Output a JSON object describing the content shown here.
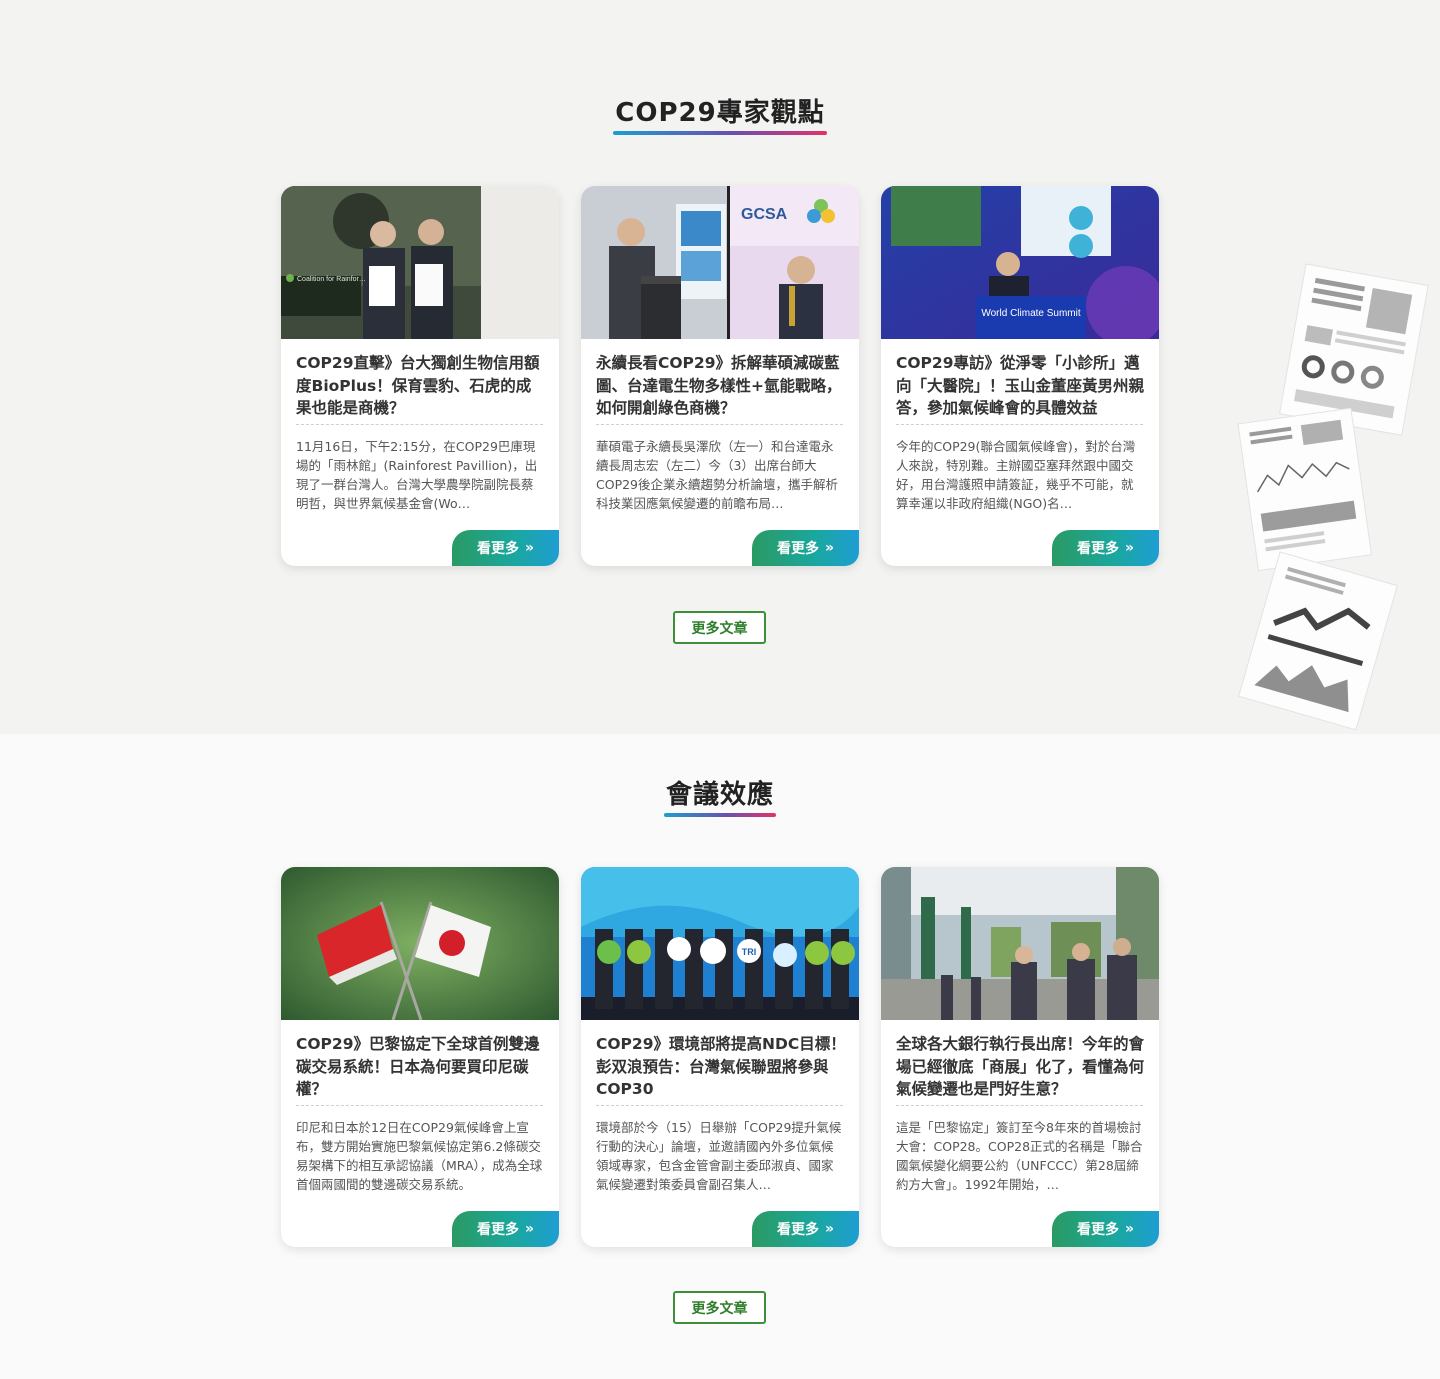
{
  "sections": [
    {
      "title": "COP29專家觀點",
      "more_label": "更多文章",
      "cards": [
        {
          "title": "COP29直擊》台大獨創生物信用額度BioPlus！保育雲豹、石虎的成果也能是商機？",
          "desc": "11月16日，下午2:15分，在COP29巴庫現場的「雨林館」(Rainforest Pavillion)，出現了一群台灣人。台灣大學農學院副院長蔡明哲，與世界氣候基金會(Wo…",
          "more": "看更多",
          "image_text": "Coalition for Rainfor…"
        },
        {
          "title": "永續長看COP29》拆解華碩減碳藍圖、台達電生物多樣性+氫能戰略，如何開創綠色商機？",
          "desc": "華碩電子永續長吳澤欣（左一）和台達電永續長周志宏（左二）今（3）出席台師大COP29後企業永續趨勢分析論壇，攜手解析科技業因應氣候變遷的前瞻布局…",
          "more": "看更多",
          "image_text": "GCSA"
        },
        {
          "title": "COP29專訪》從淨零「小診所」邁向「大醫院」！玉山金董座黃男州親答，參加氣候峰會的具體效益",
          "desc": "今年的COP29(聯合國氣候峰會)，對於台灣人來說，特別難。主辦國亞塞拜然跟中國交好，用台灣護照申請簽証，幾乎不可能，就算幸運以非政府組織(NGO)名…",
          "more": "看更多",
          "image_text": "World Climate Summit"
        }
      ]
    },
    {
      "title": "會議效應",
      "more_label": "更多文章",
      "cards": [
        {
          "title": "COP29》巴黎協定下全球首例雙邊碳交易系統！日本為何要買印尼碳權？",
          "desc": "印尼和日本於12日在COP29氣候峰會上宣布，雙方開始實施巴黎氣候協定第6.2條碳交易架構下的相互承認協議（MRA），成為全球首個兩國間的雙邊碳交易系統。",
          "more": "看更多",
          "image_text": ""
        },
        {
          "title": "COP29》環境部將提高NDC目標！彭双浪預告：台灣氣候聯盟將參與COP30",
          "desc": "環境部於今（15）日舉辦「COP29提升氣候行動的決心」論壇，並邀請國內外多位氣候領域專家，包含金管會副主委邱淑貞、國家氣候變遷對策委員會副召集人…",
          "more": "看更多",
          "image_text": "TRI"
        },
        {
          "title": "全球各大銀行執行長出席！今年的會場已經徹底「商展」化了，看懂為何氣候變遷也是門好生意？",
          "desc": "這是「巴黎協定」簽訂至今8年來的首場檢討大會：COP28。COP28正式的名稱是「聯合國氣候變化綱要公約（UNFCCC）第28屆締約方大會」。1992年開始，…",
          "more": "看更多",
          "image_text": ""
        }
      ]
    }
  ],
  "colors": {
    "accent_gradient": [
      "#1e9ecf",
      "#6a4fb0",
      "#e0336a"
    ],
    "button_gradient": [
      "#2a9a63",
      "#1e9ed3"
    ],
    "more_border": "#3d8f3a"
  }
}
